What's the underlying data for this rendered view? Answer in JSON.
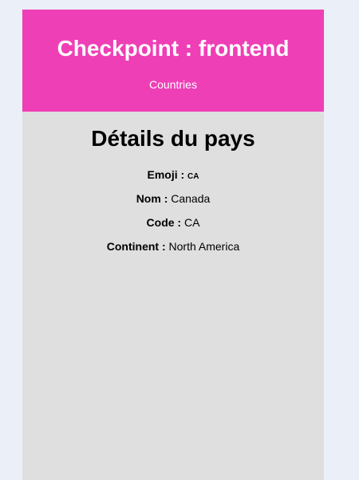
{
  "header": {
    "title": "Checkpoint : frontend",
    "nav_link": "Countries"
  },
  "main": {
    "heading": "Détails du pays",
    "fields": [
      {
        "label": "Emoji :",
        "value": "CA"
      },
      {
        "label": "Nom :",
        "value": "Canada"
      },
      {
        "label": "Code :",
        "value": "CA"
      },
      {
        "label": "Continent :",
        "value": "North America"
      }
    ]
  },
  "colors": {
    "header_bg": "#ee3fb6",
    "content_bg": "#dfdfdf",
    "page_bg": "#ebeff7"
  }
}
